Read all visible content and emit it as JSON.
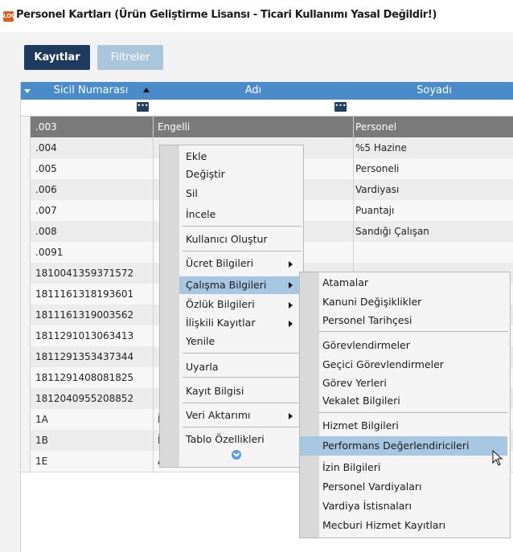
{
  "window": {
    "title": "Personel Kartları (Ürün Geliştirme Lisansı - Ticari Kullanımı Yasal Değildir!)",
    "app_icon_text": "LOGO"
  },
  "tabs": [
    "Kayıtlar",
    "Filtreler"
  ],
  "grid": {
    "columns": [
      "Sicil Numarası",
      "Adı",
      "Soyadı"
    ],
    "filter_button_label": "•••",
    "rows": [
      {
        "sicil": ".003",
        "adi": "Engelli",
        "soyadi": "Personel"
      },
      {
        "sicil": ".004",
        "adi": "",
        "soyadi": "%5 Hazine"
      },
      {
        "sicil": ".005",
        "adi": "",
        "soyadi": "Personeli"
      },
      {
        "sicil": ".006",
        "adi": "",
        "soyadi": "Vardiyası"
      },
      {
        "sicil": ".007",
        "adi": "",
        "soyadi": "Puantajı"
      },
      {
        "sicil": ".008",
        "adi": "",
        "soyadi": "Sandığı Çalışan"
      },
      {
        "sicil": ".0091",
        "adi": "",
        "soyadi": ""
      },
      {
        "sicil": "1810041359371572",
        "adi": "",
        "soyadi": ""
      },
      {
        "sicil": "1811161318193601",
        "adi": "",
        "soyadi": ""
      },
      {
        "sicil": "1811161319003562",
        "adi": "",
        "soyadi": ""
      },
      {
        "sicil": "1811291013063413",
        "adi": "",
        "soyadi": ""
      },
      {
        "sicil": "1811291353437344",
        "adi": "",
        "soyadi": ""
      },
      {
        "sicil": "1811291408081825",
        "adi": "",
        "soyadi": ""
      },
      {
        "sicil": "1812040955208852",
        "adi": "",
        "soyadi": ""
      },
      {
        "sicil": "1A",
        "adi": "İzin",
        "soyadi": ""
      },
      {
        "sicil": "1B",
        "adi": "İzin",
        "soyadi": ""
      },
      {
        "sicil": "1E",
        "adi": "Asgari",
        "soyadi": ""
      }
    ]
  },
  "context_menu": {
    "items": [
      "Ekle",
      "Değiştir",
      "Sil",
      "İncele",
      "Kullanıcı Oluştur",
      "Ücret Bilgileri",
      "Çalışma Bilgileri",
      "Özlük Bilgileri",
      "İlişkili Kayıtlar",
      "Yenile",
      "Uyarla",
      "Kayıt Bilgisi",
      "Veri Aktarımı",
      "Tablo Özellikleri"
    ]
  },
  "submenu": {
    "items": [
      "Atamalar",
      "Kanuni Değişiklikler",
      "Personel Tarihçesi",
      "Görevlendirmeler",
      "Geçici Görevlendirmeler",
      "Görev Yerleri",
      "Vekalet Bilgileri",
      "Hizmet Bilgileri",
      "Performans Değerlendiricileri",
      "İzin Bilgileri",
      "Personel Vardiyaları",
      "Vardiya İstisnaları",
      "Mecburi Hizmet Kayıtları"
    ]
  },
  "colors": {
    "header_blue": "#4a8cc9",
    "tab_active": "#1e3a5c",
    "tab_inactive": "#a9c6dd",
    "menu_highlight": "#a7c6e1",
    "selected_row": "#7a7a7a"
  },
  "icons": {
    "app": "logo-app-icon",
    "menu_more": "chevron-down-blue-icon",
    "cursor": "mouse-pointer-icon"
  }
}
